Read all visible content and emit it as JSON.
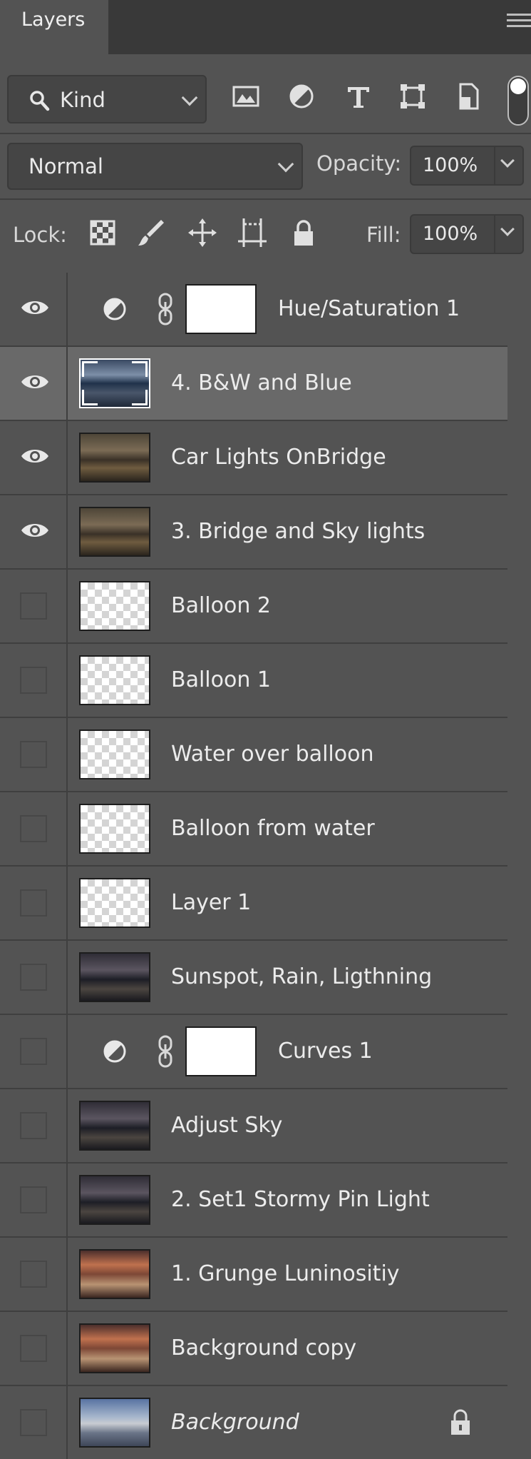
{
  "panel": {
    "tab_label": "Layers"
  },
  "filter": {
    "kind_label": "Kind",
    "icons": [
      "image-filter-icon",
      "adjustment-filter-icon",
      "type-filter-icon",
      "shape-filter-icon",
      "smart-object-filter-icon"
    ]
  },
  "blend": {
    "mode": "Normal",
    "opacity_label": "Opacity:",
    "opacity_value": "100%"
  },
  "lock": {
    "label": "Lock:",
    "icons": [
      "lock-transparent-pixels-icon",
      "lock-image-pixels-icon",
      "lock-position-icon",
      "lock-artboard-icon",
      "lock-all-icon"
    ],
    "fill_label": "Fill:",
    "fill_value": "100%"
  },
  "layers": [
    {
      "name": "Hue/Saturation 1",
      "visible": true,
      "type": "adjustment",
      "selected": false
    },
    {
      "name": "4. B&W and Blue",
      "visible": true,
      "type": "photo",
      "selected": true,
      "thumb": "blue"
    },
    {
      "name": "Car Lights OnBridge",
      "visible": true,
      "type": "photo",
      "selected": false,
      "thumb": "warm"
    },
    {
      "name": "3. Bridge and Sky lights",
      "visible": true,
      "type": "photo",
      "selected": false,
      "thumb": "warm"
    },
    {
      "name": "Balloon 2",
      "visible": false,
      "type": "transparent",
      "selected": false
    },
    {
      "name": "Balloon 1",
      "visible": false,
      "type": "transparent",
      "selected": false
    },
    {
      "name": "Water over balloon",
      "visible": false,
      "type": "transparent",
      "selected": false
    },
    {
      "name": "Balloon from water",
      "visible": false,
      "type": "transparent",
      "selected": false
    },
    {
      "name": "Layer 1",
      "visible": false,
      "type": "transparent",
      "selected": false
    },
    {
      "name": "Sunspot, Rain, Ligthning",
      "visible": false,
      "type": "photo",
      "selected": false,
      "thumb": "dark"
    },
    {
      "name": "Curves 1",
      "visible": false,
      "type": "adjustment",
      "selected": false
    },
    {
      "name": "Adjust Sky",
      "visible": false,
      "type": "photo",
      "selected": false,
      "thumb": "dark"
    },
    {
      "name": "2. Set1 Stormy Pin Light",
      "visible": false,
      "type": "photo",
      "selected": false,
      "thumb": "dark"
    },
    {
      "name": "1.  Grunge Luninositiy",
      "visible": false,
      "type": "photo",
      "selected": false,
      "thumb": "sunset"
    },
    {
      "name": "Background copy",
      "visible": false,
      "type": "photo",
      "selected": false,
      "thumb": "sunset"
    },
    {
      "name": "Background",
      "visible": false,
      "type": "photo",
      "selected": false,
      "thumb": "day",
      "locked": true,
      "italic": true
    }
  ],
  "colors": {
    "panel_bg": "#535353",
    "header_bg": "#393939",
    "selected_row": "#696969",
    "divider": "#3f3f3f"
  }
}
